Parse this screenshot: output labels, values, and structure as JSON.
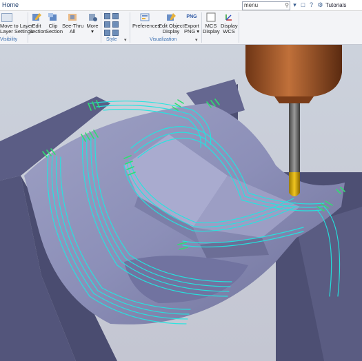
{
  "titlebar": {
    "home_tab": "Home",
    "search_value": "menu",
    "tutorials": "Tutorials"
  },
  "ribbon": {
    "visibility": {
      "layer_button": [
        "Move to Layer",
        "Layer Settings"
      ],
      "group_label": "Visibility"
    },
    "section": {
      "edit_section": [
        "Edit",
        "Section"
      ],
      "clip_section": [
        "Clip",
        "Section"
      ],
      "see_thru": [
        "See-Thru",
        "All"
      ],
      "more": "More"
    },
    "style": {
      "group_label": "Style"
    },
    "visualization": {
      "preferences": "Preferences",
      "edit_object_display": [
        "Edit Object",
        "Display"
      ],
      "export_png": [
        "Export",
        "PNG"
      ],
      "png_icon_text": "PNG",
      "mcs_display": [
        "MCS",
        "Display"
      ],
      "display_wcs": [
        "Display",
        "WCS"
      ],
      "group_label": "Visualization"
    }
  },
  "icons": {
    "search": "search-icon",
    "dropdown": "chevron-down-icon",
    "tutorials": "gear-icon"
  },
  "colors": {
    "toolpath": "#22e6e0",
    "toolpath_engage": "#2de070",
    "part": "#5d5f86",
    "spindle": "#a8582d",
    "tool_tip": "#e1b200",
    "background": "#c9ccd6"
  }
}
